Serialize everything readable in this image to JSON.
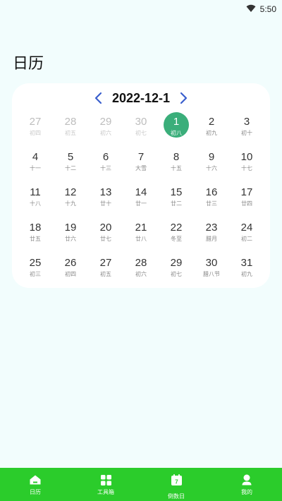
{
  "status_bar": {
    "time": "5:50"
  },
  "page": {
    "title": "日历"
  },
  "calendar": {
    "month_label": "2022-12-1",
    "weeks": [
      [
        {
          "day": "27",
          "lunar": "初四",
          "other": true
        },
        {
          "day": "28",
          "lunar": "初五",
          "other": true
        },
        {
          "day": "29",
          "lunar": "初六",
          "other": true
        },
        {
          "day": "30",
          "lunar": "初七",
          "other": true
        },
        {
          "day": "1",
          "lunar": "初八",
          "selected": true
        },
        {
          "day": "2",
          "lunar": "初九"
        },
        {
          "day": "3",
          "lunar": "初十"
        }
      ],
      [
        {
          "day": "4",
          "lunar": "十一"
        },
        {
          "day": "5",
          "lunar": "十二"
        },
        {
          "day": "6",
          "lunar": "十三"
        },
        {
          "day": "7",
          "lunar": "大雪"
        },
        {
          "day": "8",
          "lunar": "十五"
        },
        {
          "day": "9",
          "lunar": "十六"
        },
        {
          "day": "10",
          "lunar": "十七"
        }
      ],
      [
        {
          "day": "11",
          "lunar": "十八"
        },
        {
          "day": "12",
          "lunar": "十九"
        },
        {
          "day": "13",
          "lunar": "廿十"
        },
        {
          "day": "14",
          "lunar": "廿一"
        },
        {
          "day": "15",
          "lunar": "廿二"
        },
        {
          "day": "16",
          "lunar": "廿三"
        },
        {
          "day": "17",
          "lunar": "廿四"
        }
      ],
      [
        {
          "day": "18",
          "lunar": "廿五"
        },
        {
          "day": "19",
          "lunar": "廿六"
        },
        {
          "day": "20",
          "lunar": "廿七"
        },
        {
          "day": "21",
          "lunar": "廿八"
        },
        {
          "day": "22",
          "lunar": "冬至"
        },
        {
          "day": "23",
          "lunar": "腊月"
        },
        {
          "day": "24",
          "lunar": "初二"
        }
      ],
      [
        {
          "day": "25",
          "lunar": "初三"
        },
        {
          "day": "26",
          "lunar": "初四"
        },
        {
          "day": "27",
          "lunar": "初五"
        },
        {
          "day": "28",
          "lunar": "初六"
        },
        {
          "day": "29",
          "lunar": "初七"
        },
        {
          "day": "30",
          "lunar": "腊八节"
        },
        {
          "day": "31",
          "lunar": "初九"
        }
      ]
    ]
  },
  "bottom_nav": {
    "tabs": [
      {
        "label": "日历",
        "icon": "home-icon"
      },
      {
        "label": "工具箱",
        "icon": "grid-icon"
      },
      {
        "label": "倒数日",
        "icon": "calendar-icon",
        "icon_text": "7"
      },
      {
        "label": "我的",
        "icon": "user-icon"
      }
    ]
  },
  "colors": {
    "background": "#f2fdfd",
    "selected": "#3aae7a",
    "nav": "#2bcc2b",
    "arrow": "#3a5fcd"
  }
}
